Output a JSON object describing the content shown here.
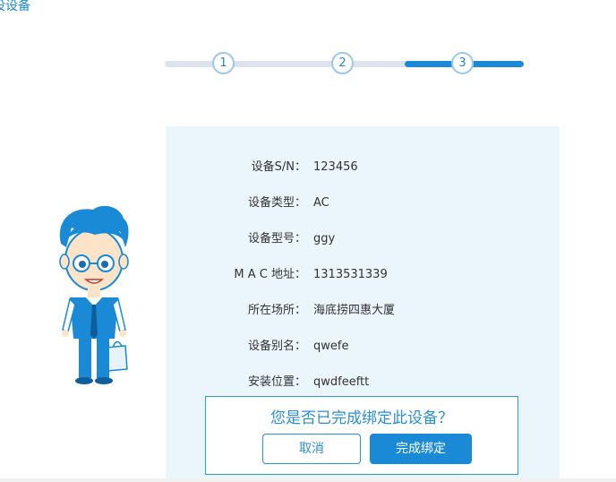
{
  "page": {
    "title": "设设备"
  },
  "stepper": {
    "current_step": 3,
    "steps": [
      "1",
      "2",
      "3"
    ]
  },
  "device_info": [
    {
      "label": "设备S/N：",
      "value": "123456"
    },
    {
      "label": "设备类型：",
      "value": "AC"
    },
    {
      "label": "设备型号：",
      "value": "ggy"
    },
    {
      "label": "M A C 地址：",
      "value": "1313531339"
    },
    {
      "label": "所在场所：",
      "value": "海底捞四惠大厦"
    },
    {
      "label": "设备别名：",
      "value": "qwefe"
    },
    {
      "label": "安装位置：",
      "value": "qwdfeeftt"
    }
  ],
  "confirm": {
    "question": "您是否已完成绑定此设备？",
    "cancel_label": "取消",
    "ok_label": "完成绑定"
  },
  "colors": {
    "accent": "#1a8ad6",
    "panel_bg": "#ebf5fc",
    "track_gray": "#dde3ec"
  }
}
